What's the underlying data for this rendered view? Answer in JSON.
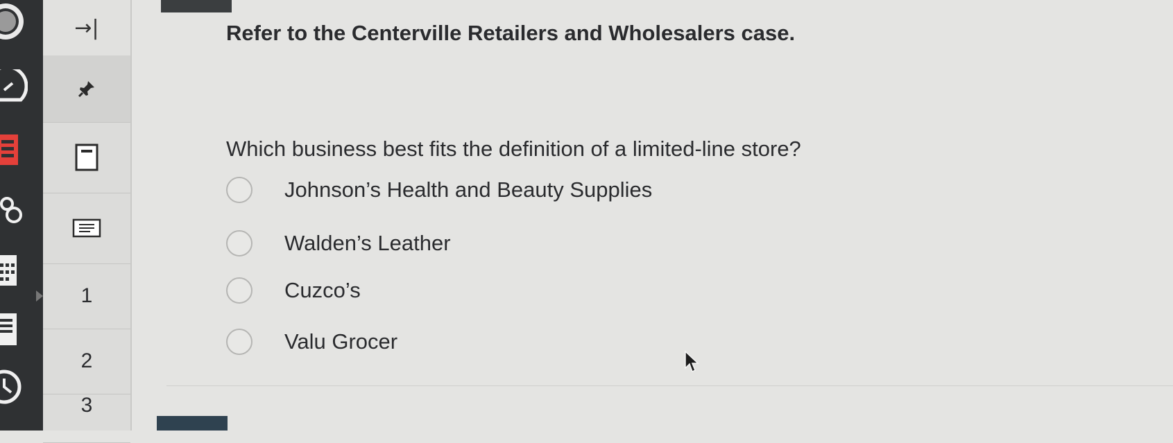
{
  "question_nav": {
    "collapse_label": "→|",
    "items": [
      {
        "number": "1"
      },
      {
        "number": "2"
      },
      {
        "number": "3"
      }
    ]
  },
  "question": {
    "case_reference": "Refer to the Centerville Retailers and Wholesalers case.",
    "prompt": "Which business best fits the definition of a limited-line store?",
    "options": [
      {
        "label": "Johnson’s Health and Beauty Supplies",
        "selected": false
      },
      {
        "label": "Walden’s Leather",
        "selected": false
      },
      {
        "label": "Cuzco’s",
        "selected": false
      },
      {
        "label": "Valu Grocer",
        "selected": false
      }
    ]
  },
  "icons": {
    "global_nav": [
      "account-icon",
      "dashboard-icon",
      "courses-icon",
      "groups-icon",
      "calendar-icon",
      "inbox-icon",
      "history-icon"
    ],
    "question_tools": [
      "pin-icon",
      "calculator-icon",
      "notes-icon"
    ]
  },
  "colors": {
    "global_nav_bg": "#2f3133",
    "page_bg": "#e4e4e2",
    "text": "#2a2b2e"
  }
}
